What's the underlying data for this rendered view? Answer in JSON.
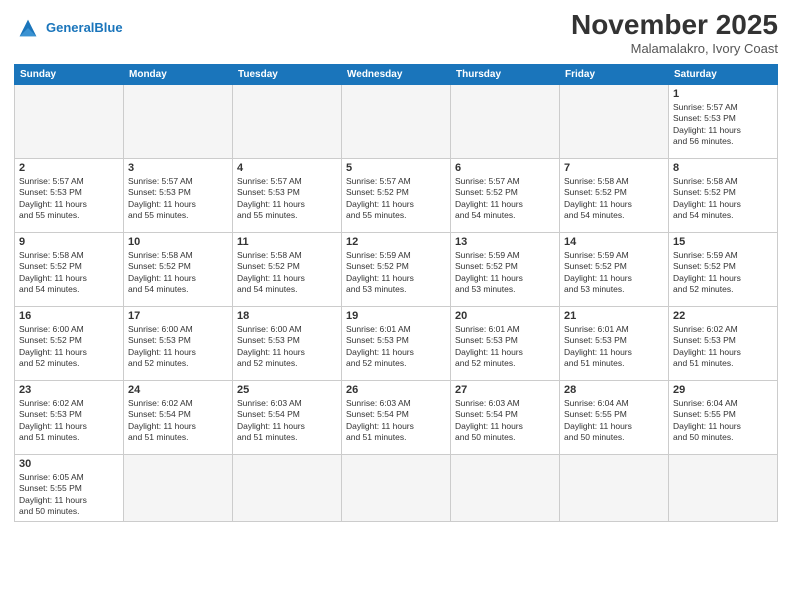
{
  "header": {
    "logo_line1": "General",
    "logo_line2": "Blue",
    "title": "November 2025",
    "subtitle": "Malamalakro, Ivory Coast"
  },
  "weekdays": [
    "Sunday",
    "Monday",
    "Tuesday",
    "Wednesday",
    "Thursday",
    "Friday",
    "Saturday"
  ],
  "weeks": [
    [
      {
        "day": "",
        "info": ""
      },
      {
        "day": "",
        "info": ""
      },
      {
        "day": "",
        "info": ""
      },
      {
        "day": "",
        "info": ""
      },
      {
        "day": "",
        "info": ""
      },
      {
        "day": "",
        "info": ""
      },
      {
        "day": "1",
        "info": "Sunrise: 5:57 AM\nSunset: 5:53 PM\nDaylight: 11 hours\nand 56 minutes."
      }
    ],
    [
      {
        "day": "2",
        "info": "Sunrise: 5:57 AM\nSunset: 5:53 PM\nDaylight: 11 hours\nand 55 minutes."
      },
      {
        "day": "3",
        "info": "Sunrise: 5:57 AM\nSunset: 5:53 PM\nDaylight: 11 hours\nand 55 minutes."
      },
      {
        "day": "4",
        "info": "Sunrise: 5:57 AM\nSunset: 5:53 PM\nDaylight: 11 hours\nand 55 minutes."
      },
      {
        "day": "5",
        "info": "Sunrise: 5:57 AM\nSunset: 5:52 PM\nDaylight: 11 hours\nand 55 minutes."
      },
      {
        "day": "6",
        "info": "Sunrise: 5:57 AM\nSunset: 5:52 PM\nDaylight: 11 hours\nand 54 minutes."
      },
      {
        "day": "7",
        "info": "Sunrise: 5:58 AM\nSunset: 5:52 PM\nDaylight: 11 hours\nand 54 minutes."
      },
      {
        "day": "8",
        "info": "Sunrise: 5:58 AM\nSunset: 5:52 PM\nDaylight: 11 hours\nand 54 minutes."
      }
    ],
    [
      {
        "day": "9",
        "info": "Sunrise: 5:58 AM\nSunset: 5:52 PM\nDaylight: 11 hours\nand 54 minutes."
      },
      {
        "day": "10",
        "info": "Sunrise: 5:58 AM\nSunset: 5:52 PM\nDaylight: 11 hours\nand 54 minutes."
      },
      {
        "day": "11",
        "info": "Sunrise: 5:58 AM\nSunset: 5:52 PM\nDaylight: 11 hours\nand 54 minutes."
      },
      {
        "day": "12",
        "info": "Sunrise: 5:59 AM\nSunset: 5:52 PM\nDaylight: 11 hours\nand 53 minutes."
      },
      {
        "day": "13",
        "info": "Sunrise: 5:59 AM\nSunset: 5:52 PM\nDaylight: 11 hours\nand 53 minutes."
      },
      {
        "day": "14",
        "info": "Sunrise: 5:59 AM\nSunset: 5:52 PM\nDaylight: 11 hours\nand 53 minutes."
      },
      {
        "day": "15",
        "info": "Sunrise: 5:59 AM\nSunset: 5:52 PM\nDaylight: 11 hours\nand 52 minutes."
      }
    ],
    [
      {
        "day": "16",
        "info": "Sunrise: 6:00 AM\nSunset: 5:52 PM\nDaylight: 11 hours\nand 52 minutes."
      },
      {
        "day": "17",
        "info": "Sunrise: 6:00 AM\nSunset: 5:53 PM\nDaylight: 11 hours\nand 52 minutes."
      },
      {
        "day": "18",
        "info": "Sunrise: 6:00 AM\nSunset: 5:53 PM\nDaylight: 11 hours\nand 52 minutes."
      },
      {
        "day": "19",
        "info": "Sunrise: 6:01 AM\nSunset: 5:53 PM\nDaylight: 11 hours\nand 52 minutes."
      },
      {
        "day": "20",
        "info": "Sunrise: 6:01 AM\nSunset: 5:53 PM\nDaylight: 11 hours\nand 52 minutes."
      },
      {
        "day": "21",
        "info": "Sunrise: 6:01 AM\nSunset: 5:53 PM\nDaylight: 11 hours\nand 51 minutes."
      },
      {
        "day": "22",
        "info": "Sunrise: 6:02 AM\nSunset: 5:53 PM\nDaylight: 11 hours\nand 51 minutes."
      }
    ],
    [
      {
        "day": "23",
        "info": "Sunrise: 6:02 AM\nSunset: 5:53 PM\nDaylight: 11 hours\nand 51 minutes."
      },
      {
        "day": "24",
        "info": "Sunrise: 6:02 AM\nSunset: 5:54 PM\nDaylight: 11 hours\nand 51 minutes."
      },
      {
        "day": "25",
        "info": "Sunrise: 6:03 AM\nSunset: 5:54 PM\nDaylight: 11 hours\nand 51 minutes."
      },
      {
        "day": "26",
        "info": "Sunrise: 6:03 AM\nSunset: 5:54 PM\nDaylight: 11 hours\nand 51 minutes."
      },
      {
        "day": "27",
        "info": "Sunrise: 6:03 AM\nSunset: 5:54 PM\nDaylight: 11 hours\nand 50 minutes."
      },
      {
        "day": "28",
        "info": "Sunrise: 6:04 AM\nSunset: 5:55 PM\nDaylight: 11 hours\nand 50 minutes."
      },
      {
        "day": "29",
        "info": "Sunrise: 6:04 AM\nSunset: 5:55 PM\nDaylight: 11 hours\nand 50 minutes."
      }
    ],
    [
      {
        "day": "30",
        "info": "Sunrise: 6:05 AM\nSunset: 5:55 PM\nDaylight: 11 hours\nand 50 minutes."
      },
      {
        "day": "",
        "info": ""
      },
      {
        "day": "",
        "info": ""
      },
      {
        "day": "",
        "info": ""
      },
      {
        "day": "",
        "info": ""
      },
      {
        "day": "",
        "info": ""
      },
      {
        "day": "",
        "info": ""
      }
    ]
  ]
}
